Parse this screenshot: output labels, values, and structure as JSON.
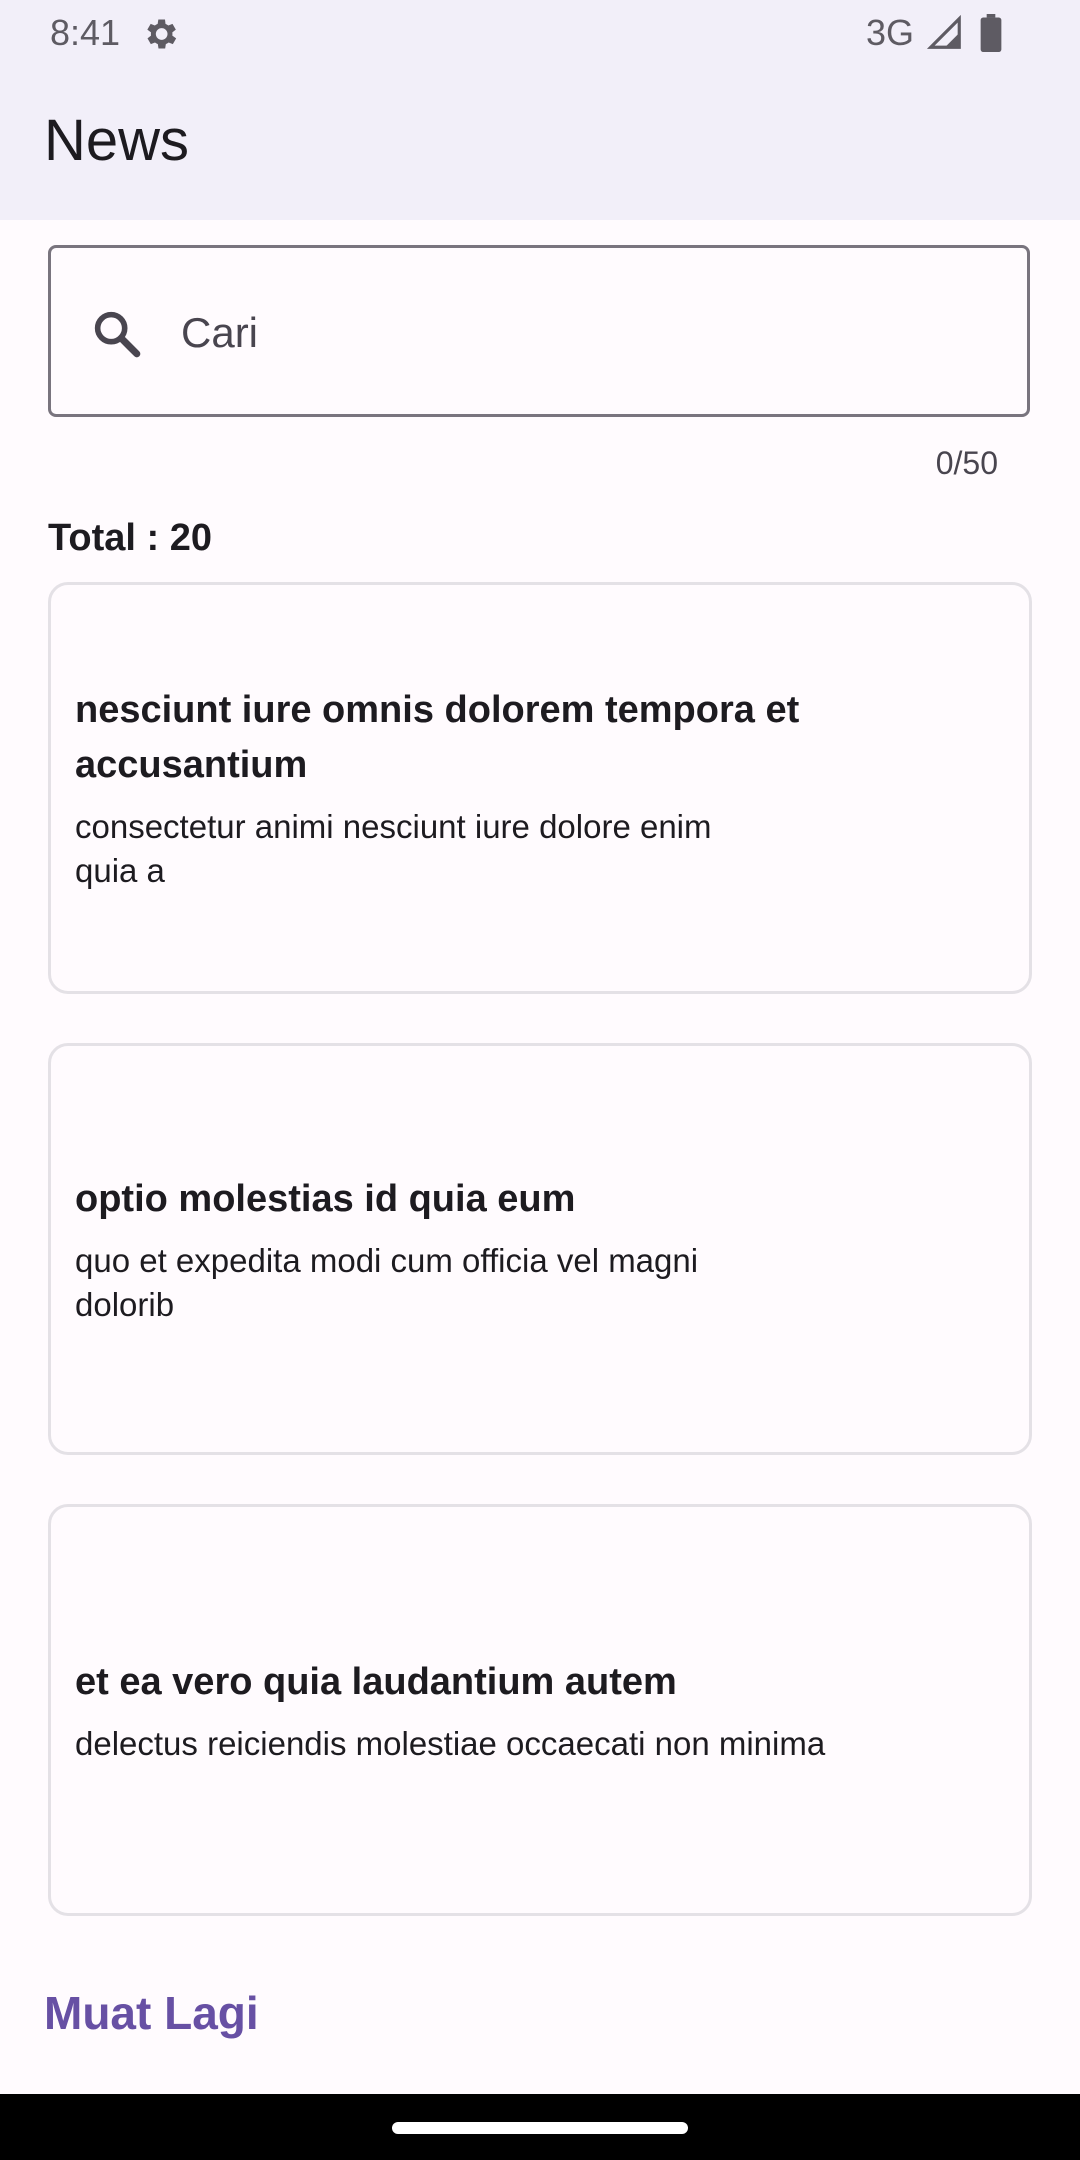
{
  "status_bar": {
    "time": "8:41",
    "network": "3G",
    "icons": [
      "settings-icon",
      "signal-icon",
      "battery-icon"
    ]
  },
  "app_bar": {
    "title": "News"
  },
  "search": {
    "placeholder": "Cari",
    "value": "",
    "counter": "0/50",
    "icon": "search-icon"
  },
  "total": {
    "label": "Total : 20"
  },
  "news": [
    {
      "title": "nesciunt iure omnis dolorem tempora et accusantium",
      "body": "consectetur animi nesciunt iure dolore enim quia a"
    },
    {
      "title": "optio molestias id quia eum",
      "body": "quo et expedita modi cum officia vel magni dolorib"
    },
    {
      "title": "et ea vero quia laudantium autem",
      "body": "delectus reiciendis molestiae occaecati non minima"
    }
  ],
  "load_more": {
    "label": "Muat Lagi"
  },
  "colors": {
    "app_bar_bg": "#F2EFF9",
    "accent": "#6750A4",
    "text": "#1D1B20",
    "card_border": "#E4E1E6"
  }
}
